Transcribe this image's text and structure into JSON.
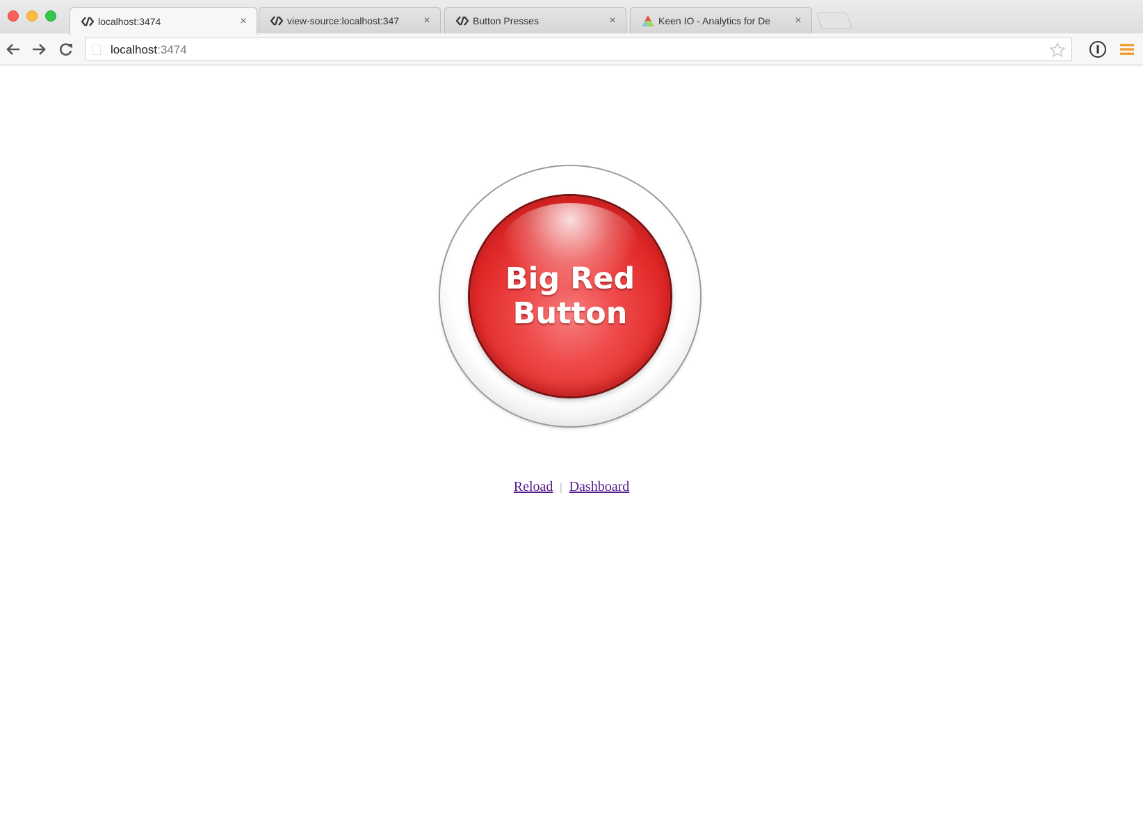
{
  "browser": {
    "tabs": [
      {
        "title": "localhost:3474",
        "active": true,
        "favicon": "code-brackets-icon"
      },
      {
        "title": "view-source:localhost:347",
        "active": false,
        "favicon": "code-brackets-icon"
      },
      {
        "title": "Button Presses",
        "active": false,
        "favicon": "code-brackets-icon"
      },
      {
        "title": "Keen IO - Analytics for De",
        "active": false,
        "favicon": "keen-triangle-icon"
      }
    ],
    "address_bar": {
      "host": "localhost",
      "port": ":3474"
    }
  },
  "page": {
    "big_button_line1": "Big Red",
    "big_button_line2": "Button",
    "links": {
      "reload": "Reload",
      "separator": "|",
      "dashboard": "Dashboard"
    }
  },
  "colors": {
    "button_red": "#e22a2a",
    "link_visited": "#551a8b",
    "menu_orange": "#f0a030",
    "keen_icon": [
      "#e8504a",
      "#7ecbd6",
      "#a5d468"
    ]
  }
}
